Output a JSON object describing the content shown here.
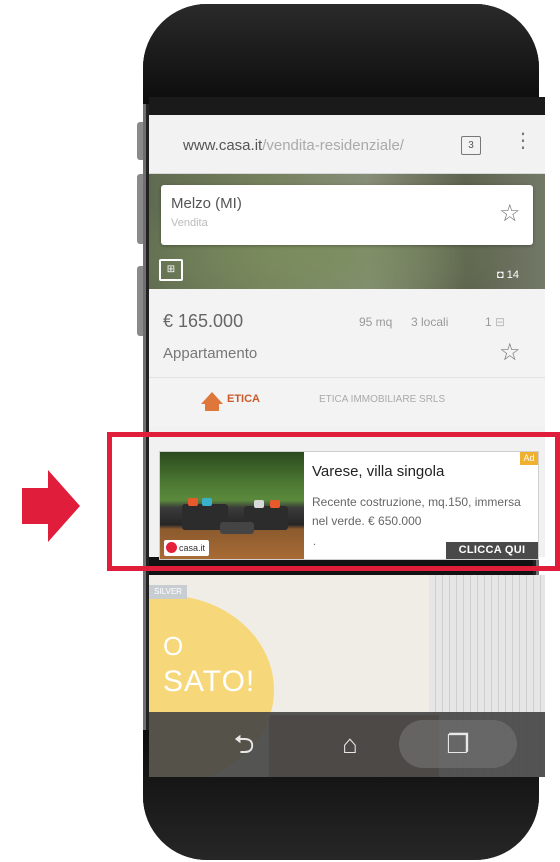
{
  "browser": {
    "url_domain": "www.casa.it",
    "url_path": "/vendita-residenziale/",
    "tab_count": "3",
    "menu_glyph": "⋮"
  },
  "listing": {
    "city": "Melzo (MI)",
    "contract": "Vendita",
    "photo_count": "14",
    "plan_glyph": "⊞",
    "price": "€ 165.000",
    "surface": "95 mq",
    "rooms": "3 locali",
    "baths": "1",
    "property_type": "Appartamento",
    "agency_brand": "ETICA",
    "agency_name": "ETICA IMMOBILIARE SRLS"
  },
  "ad": {
    "badge": "Ad",
    "title": "Varese, villa singola",
    "description": "Recente costruzione, mq.150, immersa nel verde. € 650.000",
    "dot": ".",
    "cta": "CLICCA QUI",
    "logo_text": "casa.it"
  },
  "listing2": {
    "badge": "SILVER",
    "promo_line1": "O",
    "promo_line2": "SATO!"
  },
  "navbar": {
    "back_glyph": "⮌",
    "home_glyph": "⌂",
    "recent_glyph": "❐"
  },
  "annotation": {
    "highlight_color": "#e11d3c"
  }
}
